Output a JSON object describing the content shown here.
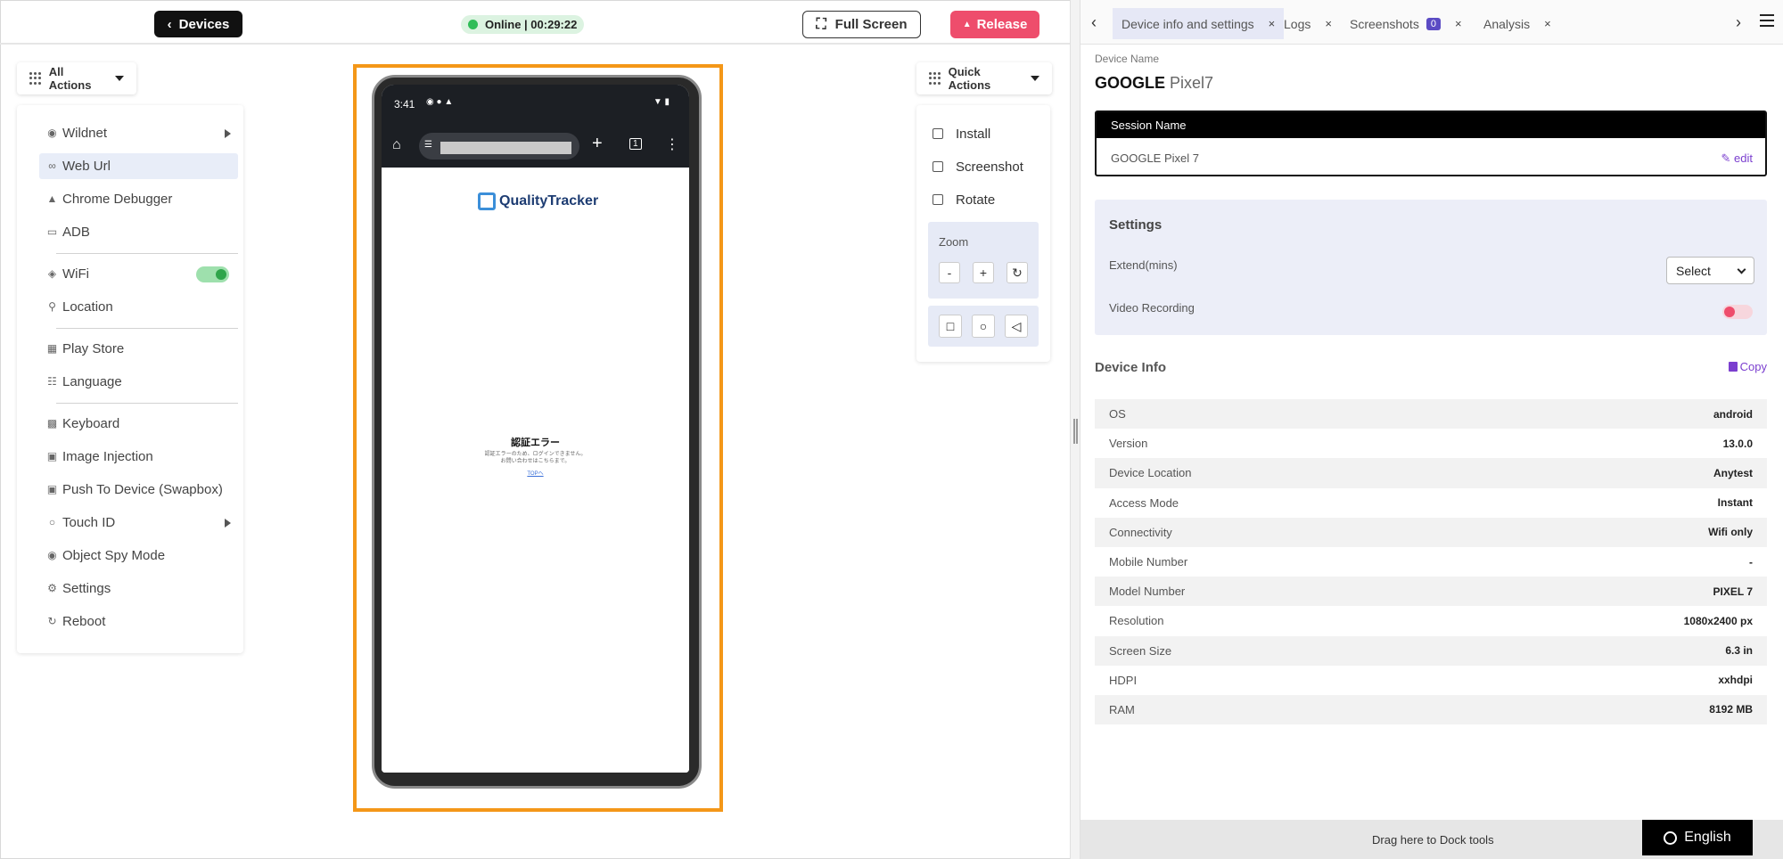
{
  "topbar": {
    "devices_label": "Devices",
    "status_text": "Online | 00:29:22",
    "fullscreen_label": "Full Screen",
    "release_label": "Release"
  },
  "left": {
    "all_actions_label": "All Actions",
    "items": [
      {
        "label": "Wildnet",
        "icon": "wifi-signal-icon"
      },
      {
        "label": "Web Url",
        "icon": "link-icon"
      },
      {
        "label": "Chrome Debugger",
        "icon": "bug-icon"
      },
      {
        "label": "ADB",
        "icon": "terminal-icon"
      },
      {
        "label": "WiFi",
        "icon": "wifi-icon"
      },
      {
        "label": "Location",
        "icon": "location-pin-icon"
      },
      {
        "label": "Play Store",
        "icon": "grid-icon"
      },
      {
        "label": "Language",
        "icon": "translate-icon"
      },
      {
        "label": "Keyboard",
        "icon": "keyboard-icon"
      },
      {
        "label": "Image Injection",
        "icon": "image-icon"
      },
      {
        "label": "Push To Device (Swapbox)",
        "icon": "upload-icon"
      },
      {
        "label": "Touch ID",
        "icon": "fingerprint-icon"
      },
      {
        "label": "Object Spy Mode",
        "icon": "spy-icon"
      },
      {
        "label": "Settings",
        "icon": "gear-icon"
      },
      {
        "label": "Reboot",
        "icon": "refresh-icon"
      }
    ]
  },
  "phone": {
    "time": "3:41",
    "logo_text": "QualityTracker",
    "error_title": "認証エラー",
    "error_line1": "認証エラーのため、ログインできません。",
    "error_line2": "お問い合わせはこちらまで。",
    "error_link": "TOPへ"
  },
  "quick": {
    "label": "Quick Actions",
    "install": "Install",
    "screenshot": "Screenshot",
    "rotate": "Rotate",
    "zoom_label": "Zoom",
    "zoom_minus": "-",
    "zoom_plus": "+"
  },
  "right": {
    "tabs": [
      {
        "label": "Device info and settings"
      },
      {
        "label": "Logs"
      },
      {
        "label": "Screenshots",
        "badge": "0"
      },
      {
        "label": "Analysis"
      }
    ],
    "device_name_label": "Device Name",
    "device_brand": "GOOGLE",
    "device_model": "Pixel7",
    "session_header": "Session Name",
    "session_value": "GOOGLE Pixel 7",
    "edit_label": "edit",
    "settings_title": "Settings",
    "extend_label": "Extend(mins)",
    "select_value": "Select",
    "video_label": "Video Recording",
    "device_info_title": "Device Info",
    "copy_label": "Copy",
    "info_rows": [
      {
        "k": "OS",
        "v": "android"
      },
      {
        "k": "Version",
        "v": "13.0.0"
      },
      {
        "k": "Device Location",
        "v": "Anytest"
      },
      {
        "k": "Access Mode",
        "v": "Instant"
      },
      {
        "k": "Connectivity",
        "v": "Wifi only"
      },
      {
        "k": "Mobile Number",
        "v": "-"
      },
      {
        "k": "Model Number",
        "v": "PIXEL 7"
      },
      {
        "k": "Resolution",
        "v": "1080x2400 px"
      },
      {
        "k": "Screen Size",
        "v": "6.3 in"
      },
      {
        "k": "HDPI",
        "v": "xxhdpi"
      },
      {
        "k": "RAM",
        "v": "8192 MB"
      }
    ],
    "dock_text": "Drag here to Dock tools",
    "language": "English"
  },
  "colors": {
    "accent": "#7b3fcf",
    "release": "#ee4d6c",
    "online": "#2fbd57",
    "device_frame": "#f49718"
  }
}
